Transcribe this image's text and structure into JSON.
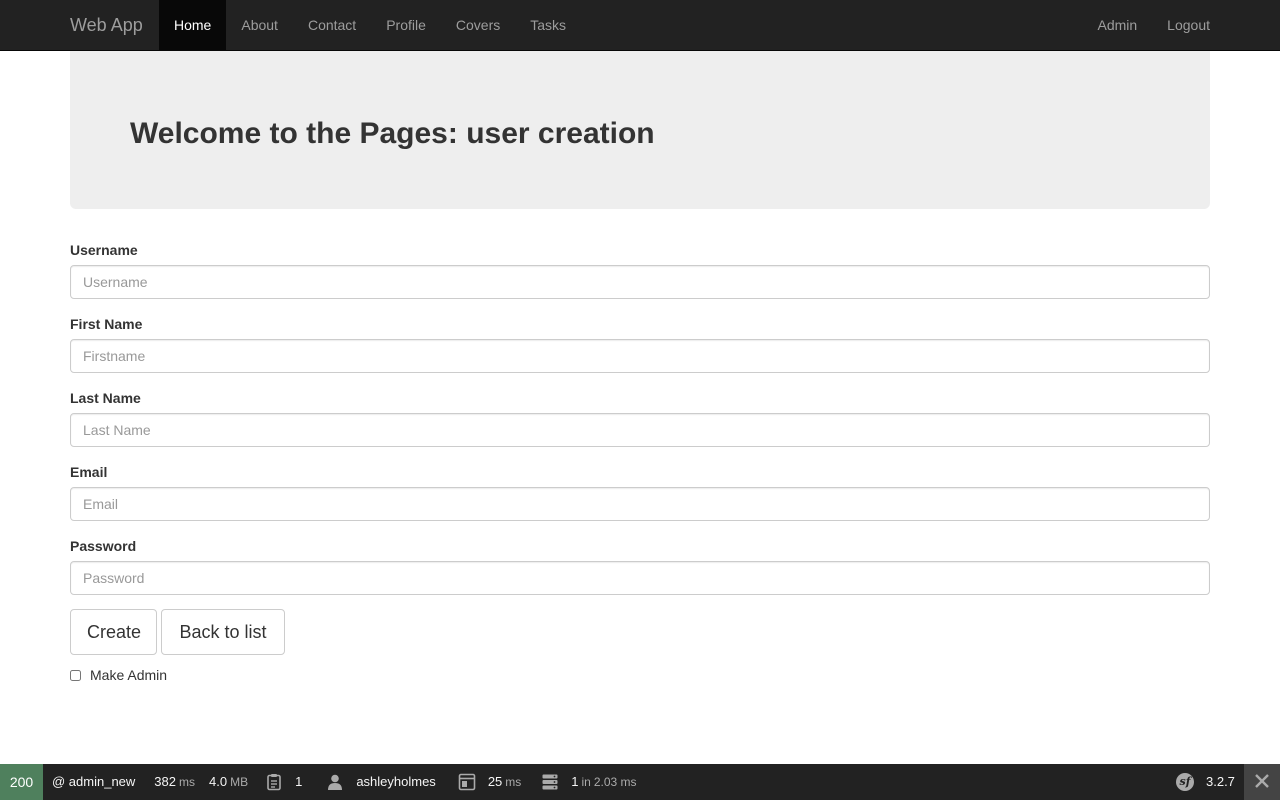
{
  "navbar": {
    "brand": "Web App",
    "left_items": [
      {
        "label": "Home",
        "active": true
      },
      {
        "label": "About"
      },
      {
        "label": "Contact"
      },
      {
        "label": "Profile"
      },
      {
        "label": "Covers"
      },
      {
        "label": "Tasks"
      }
    ],
    "right_items": [
      {
        "label": "Admin"
      },
      {
        "label": "Logout"
      }
    ]
  },
  "jumbotron": {
    "title": "Welcome to the Pages: user creation"
  },
  "form": {
    "fields": [
      {
        "label": "Username",
        "placeholder": "Username",
        "value": ""
      },
      {
        "label": "First Name",
        "placeholder": "Firstname",
        "value": ""
      },
      {
        "label": "Last Name",
        "placeholder": "Last Name",
        "value": ""
      },
      {
        "label": "Email",
        "placeholder": "Email",
        "value": ""
      },
      {
        "label": "Password",
        "placeholder": "Password",
        "value": ""
      }
    ],
    "create_label": "Create",
    "back_label": "Back to list",
    "make_admin_label": "Make Admin",
    "make_admin_checked": false
  },
  "debug_toolbar": {
    "status_code": "200",
    "route": "@ admin_new",
    "time_value": "382",
    "time_unit": "ms",
    "memory_value": "4.0",
    "memory_unit": "MB",
    "forms_count": "1",
    "user": "ashleyholmes",
    "render_value": "25",
    "render_unit": "ms",
    "db_queries": "1",
    "db_in": "in",
    "db_time": "2.03 ms",
    "version": "3.2.7",
    "status_color": "#4f805d"
  }
}
